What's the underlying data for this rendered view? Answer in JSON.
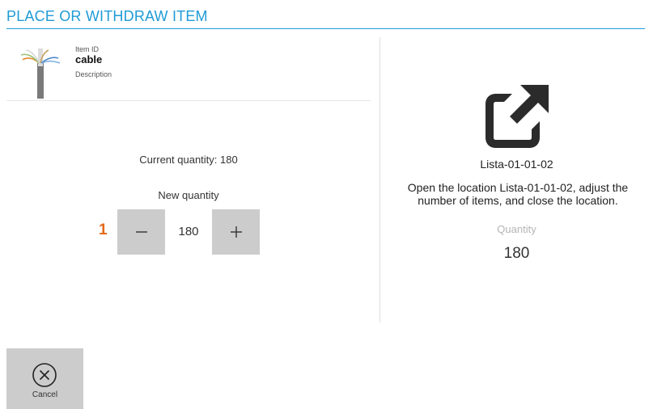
{
  "header": {
    "title": "PLACE OR WITHDRAW ITEM"
  },
  "item": {
    "id_label": "Item ID",
    "name": "cable",
    "description_label": "Description",
    "thumbnail_icon": "cable-image"
  },
  "quantity_panel": {
    "current_quantity_text": "Current quantity: 180",
    "new_quantity_label": "New quantity",
    "step_number": "1",
    "minus_symbol": "−",
    "plus_symbol": "+",
    "value": "180"
  },
  "location_panel": {
    "icon": "open-external-icon",
    "location_name": "Lista-01-01-02",
    "instruction": "Open the location Lista-01-01-02, adjust the number of items, and close the location.",
    "quantity_caption": "Quantity",
    "quantity_value": "180"
  },
  "footer": {
    "cancel_label": "Cancel",
    "cancel_icon": "close-circle-icon"
  },
  "colors": {
    "accent": "#1f9bd6",
    "step_number": "#e36a1a",
    "button_bg": "#cccccc"
  }
}
